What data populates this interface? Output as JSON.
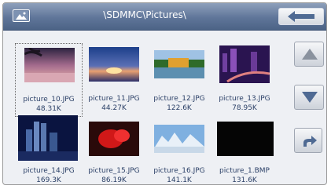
{
  "header": {
    "path": "\\SDMMC\\Pictures\\",
    "folder_icon": "picture-folder-icon",
    "back_icon": "arrow-left-icon"
  },
  "files": [
    {
      "name": "picture_10.JPG",
      "size": "48.31K",
      "selected": true
    },
    {
      "name": "picture_11.JPG",
      "size": "44.27K"
    },
    {
      "name": "picture_12.JPG",
      "size": "122.6K"
    },
    {
      "name": "picture_13.JPG",
      "size": "78.95K"
    },
    {
      "name": "picture_14.JPG",
      "size": "169.3K"
    },
    {
      "name": "picture_15.JPG",
      "size": "86.19K"
    },
    {
      "name": "picture_16.JPG",
      "size": "141.1K"
    },
    {
      "name": "picture_1.BMP",
      "size": "131.6K"
    }
  ],
  "controls": {
    "scroll_up_icon": "triangle-up-icon",
    "scroll_down_icon": "triangle-down-icon",
    "open_icon": "curved-arrow-icon"
  },
  "colors": {
    "titlebar": "#5f7599",
    "background": "#eef0f4",
    "label_text": "#2a3f66"
  }
}
